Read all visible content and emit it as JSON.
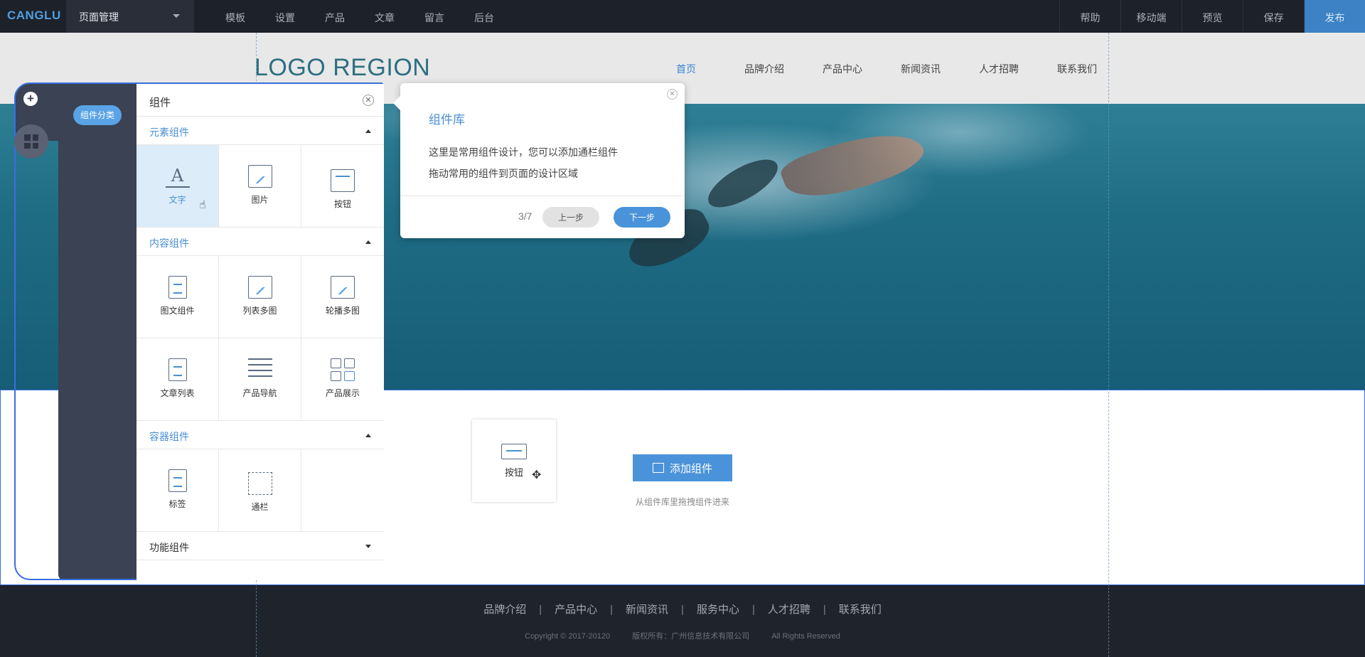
{
  "topbar": {
    "brand": "CANGLU",
    "page_select": "页面管理",
    "menu": [
      "模板",
      "设置",
      "产品",
      "文章",
      "留言",
      "后台"
    ],
    "actions": [
      "帮助",
      "移动端",
      "预览",
      "保存",
      "发布"
    ]
  },
  "site": {
    "logo": "LOGO REGION",
    "nav": [
      "首页",
      "品牌介绍",
      "产品中心",
      "新闻资讯",
      "人才招聘",
      "联系我们"
    ]
  },
  "panel": {
    "category_pill": "组件分类",
    "title": "组件",
    "sections": {
      "element": "元素组件",
      "content": "内容组件",
      "container": "容器组件",
      "function": "功能组件"
    },
    "element_items": [
      "文字",
      "图片",
      "按钮"
    ],
    "content_items": [
      "图文组件",
      "列表多图",
      "轮播多图",
      "文章列表",
      "产品导航",
      "产品展示"
    ],
    "container_items": [
      "标签",
      "通栏"
    ]
  },
  "tooltip": {
    "title": "组件库",
    "line1": "这里是常用组件设计，您可以添加通栏组件",
    "line2": "拖动常用的组件到页面的设计区域",
    "step": "3/7",
    "prev": "上一步",
    "next": "下一步"
  },
  "canvas": {
    "dragged_card_label": "按钮",
    "add_button": "添加组件",
    "add_hint": "从组件库里拖拽组件进来"
  },
  "footer": {
    "links": [
      "品牌介绍",
      "产品中心",
      "新闻资讯",
      "服务中心",
      "人才招聘",
      "联系我们"
    ],
    "separator": "|",
    "copyright": "Copyright © 2017-20120",
    "owner": "版权所有：广州信息技术有限公司",
    "rights": "All Rights Reserved"
  }
}
